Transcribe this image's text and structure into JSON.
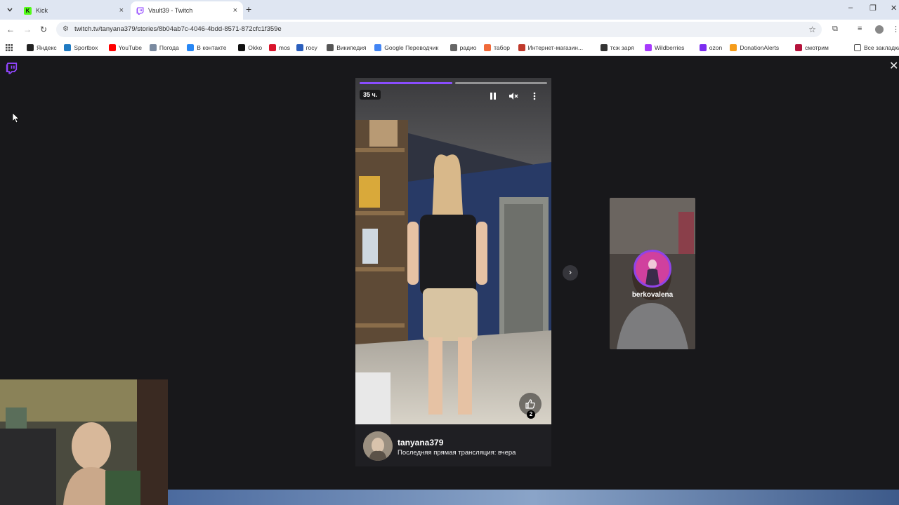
{
  "browser": {
    "tab_list_icon": "chevron-down",
    "tabs": [
      {
        "title": "Kick",
        "favicon": "kick-icon",
        "color": "#53fc18",
        "close": "×"
      },
      {
        "title": "Vault39 - Twitch",
        "favicon": "twitch-icon",
        "color": "#9146ff",
        "close": "×"
      }
    ],
    "new_tab": "+",
    "window_controls": {
      "minimize": "–",
      "restore": "❐",
      "close": "✕"
    },
    "nav": {
      "back": "←",
      "forward": "→",
      "reload": "↻"
    },
    "url": "twitch.tv/tanyana379/stories/8b04ab7c-4046-4bdd-8571-872cfc1f359e",
    "bookmarks": [
      {
        "label": "Яндекс",
        "color": "#222222"
      },
      {
        "label": "Sportbox",
        "color": "#1f7ac2"
      },
      {
        "label": "YouTube",
        "color": "#ff0000"
      },
      {
        "label": "Погода",
        "color": "#7a8aa0"
      },
      {
        "label": "В контакте",
        "color": "#2787f5"
      },
      {
        "label": "Okko",
        "color": "#111111"
      },
      {
        "label": "mos",
        "color": "#d9142b"
      },
      {
        "label": "госу",
        "color": "#2b5fbd"
      },
      {
        "label": "Википедия",
        "color": "#555555"
      },
      {
        "label": "Google Переводчик",
        "color": "#4285f4"
      },
      {
        "label": "радио",
        "color": "#666666"
      },
      {
        "label": "табор",
        "color": "#f06a3a"
      },
      {
        "label": "Интернет-магазин...",
        "color": "#c0392b"
      },
      {
        "label": "тсж заря",
        "color": "#333333"
      },
      {
        "label": "Wildberries",
        "color": "#a73afd"
      },
      {
        "label": "ozon",
        "color": "#7b2cf0"
      },
      {
        "label": "DonationAlerts",
        "color": "#f59c1a"
      },
      {
        "label": "смотрим",
        "color": "#b5123b"
      }
    ],
    "all_bookmarks": "Все закладки"
  },
  "page": {
    "close": "✕",
    "story": {
      "age": "35 ч.",
      "progress": [
        1.0,
        0.0
      ],
      "controls": {
        "pause": "pause-icon",
        "mute": "mute-icon",
        "more": "more-icon"
      },
      "likes": "2",
      "username": "tanyana379",
      "subtitle": "Последняя прямая трансляция: вчера"
    },
    "next_button": "›",
    "next_story": {
      "username": "berkovalena"
    }
  },
  "colors": {
    "page_bg": "#18181b",
    "twitch_purple": "#9146ff",
    "progress_fill": "#8a4dff"
  }
}
